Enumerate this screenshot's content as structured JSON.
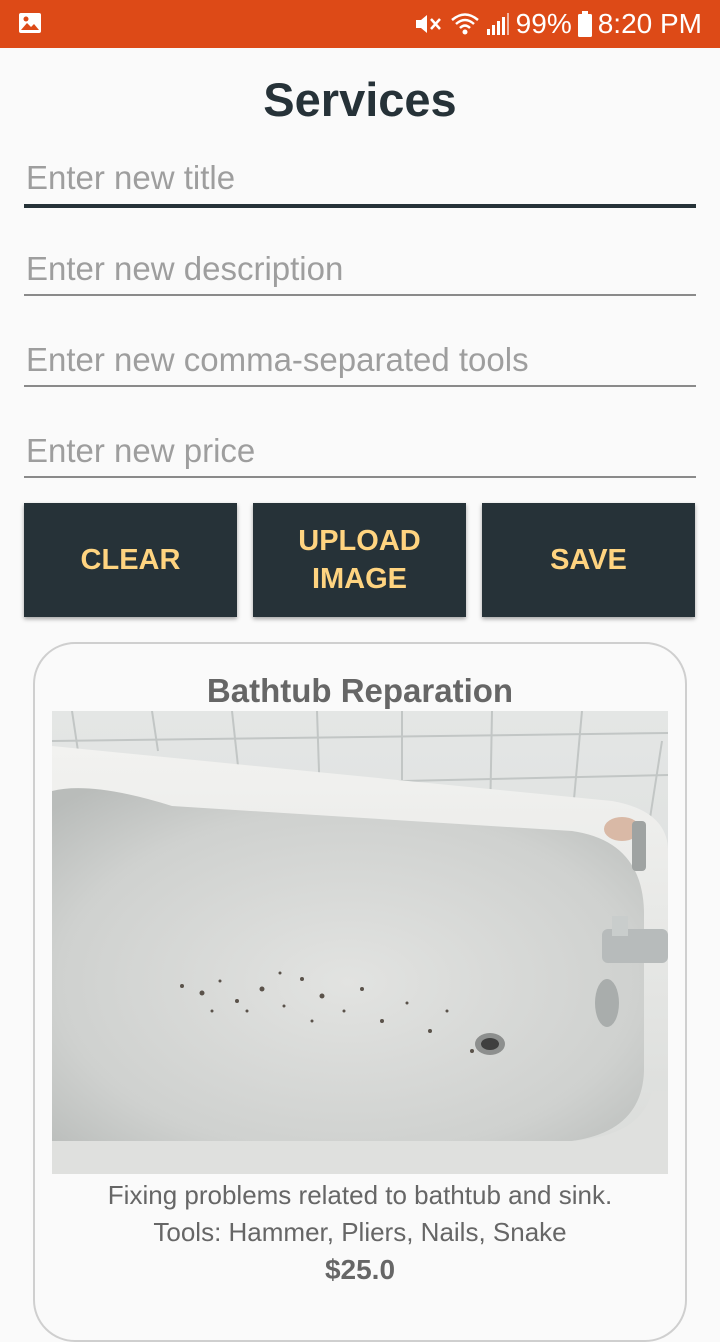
{
  "status_bar": {
    "battery": "99%",
    "time": "8:20 PM",
    "icons": [
      "gallery-icon",
      "mute-icon",
      "wifi-icon",
      "signal-icon",
      "battery-icon"
    ],
    "bg_color": "#dd4a17"
  },
  "page": {
    "title": "Services"
  },
  "form": {
    "title_placeholder": "Enter new title",
    "description_placeholder": "Enter new description",
    "tools_placeholder": "Enter new comma-separated tools",
    "price_placeholder": "Enter new price"
  },
  "buttons": {
    "clear": "CLEAR",
    "upload": "UPLOAD IMAGE",
    "save": "SAVE",
    "bg_color": "#263238",
    "text_color": "#ffd480"
  },
  "service_card": {
    "title": "Bathtub Reparation",
    "description": "Fixing problems related to bathtub and sink.",
    "tools": "Tools: Hammer, Pliers, Nails, Snake",
    "price": "$25.0"
  }
}
